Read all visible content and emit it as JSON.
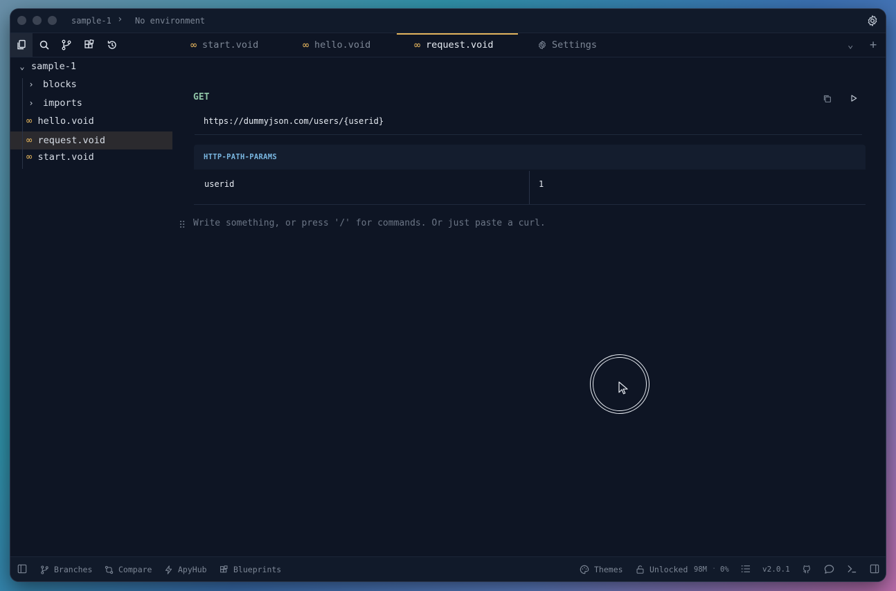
{
  "titlebar": {
    "project": "sample-1",
    "environment": "No environment"
  },
  "toolbar": {
    "tools": [
      "files-icon",
      "search-icon",
      "branch-icon",
      "blocks-icon",
      "history-icon"
    ]
  },
  "tabs": [
    {
      "label": "start.void",
      "icon": "infinity-icon",
      "active": false
    },
    {
      "label": "hello.void",
      "icon": "infinity-icon",
      "active": false
    },
    {
      "label": "request.void",
      "icon": "infinity-icon",
      "active": true
    },
    {
      "label": "Settings",
      "icon": "gear-icon",
      "active": false
    }
  ],
  "sidebar": {
    "root": "sample-1",
    "items": [
      {
        "label": "blocks",
        "type": "folder"
      },
      {
        "label": "imports",
        "type": "folder"
      },
      {
        "label": "hello.void",
        "type": "file"
      },
      {
        "label": "request.void",
        "type": "file",
        "selected": true
      },
      {
        "label": "start.void",
        "type": "file"
      }
    ]
  },
  "request": {
    "method": "GET",
    "url": "https://dummyjson.com/users/{userid}",
    "params_title": "HTTP-PATH-PARAMS",
    "params": [
      {
        "key": "userid",
        "value": "1"
      }
    ]
  },
  "editor": {
    "placeholder": "Write something, or press '/' for commands. Or just paste a curl."
  },
  "statusbar": {
    "branches": "Branches",
    "compare": "Compare",
    "apyhub": "ApyHub",
    "blueprints": "Blueprints",
    "themes": "Themes",
    "lock": "Unlocked",
    "memory": "98M",
    "cpu": "0%",
    "version": "v2.0.1"
  },
  "colors": {
    "accent": "#e2b35c",
    "method": "#8fc4a6",
    "params_title": "#79b6e0"
  }
}
